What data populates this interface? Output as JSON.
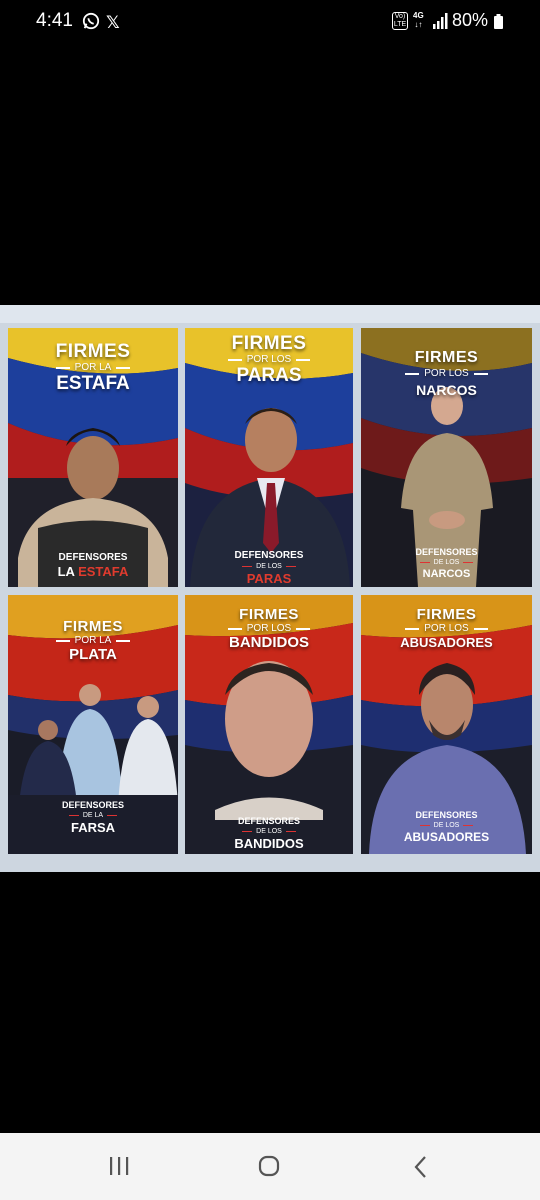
{
  "status_bar": {
    "time": "4:41",
    "network_volte": "Vo) LTE",
    "network_type": "4G",
    "battery": "80%",
    "icons": [
      "whatsapp-icon",
      "x-icon",
      "volte-icon",
      "signal-icon",
      "battery-icon"
    ]
  },
  "image": {
    "posters": [
      {
        "firmes": "FIRMES",
        "por": "POR LA",
        "big": "ESTAFA",
        "def": "DEFENSORES",
        "de": "DE LA",
        "bottom_a": "LA ",
        "bottom_b": "ESTAFA"
      },
      {
        "firmes": "FIRMES",
        "por": "POR LOS",
        "big": "PARAS",
        "def": "DEFENSORES",
        "de": "DE LOS",
        "bottom_a": "",
        "bottom_b": "PARAS"
      },
      {
        "firmes": "FIRMES",
        "por": "POR LOS",
        "big": "NARCOS",
        "def": "DEFENSORES",
        "de": "DE LOS",
        "bottom_a": "NARCOS",
        "bottom_b": ""
      },
      {
        "firmes": "FIRMES",
        "por": "POR LA",
        "big": "PLATA",
        "def": "DEFENSORES",
        "de": "DE LA",
        "bottom_a": "FARSA",
        "bottom_b": ""
      },
      {
        "firmes": "FIRMES",
        "por": "POR LOS",
        "big": "BANDIDOS",
        "def": "DEFENSORES",
        "de": "DE LOS",
        "bottom_a": "BANDIDOS",
        "bottom_b": ""
      },
      {
        "firmes": "FIRMES",
        "por": "POR LOS",
        "big": "ABUSADORES",
        "def": "DEFENSORES",
        "de": "DE LOS",
        "bottom_a": "ABUSADORES",
        "bottom_b": ""
      }
    ]
  },
  "nav_bar": {
    "icons": [
      "recent-apps-icon",
      "home-icon",
      "back-icon"
    ]
  }
}
